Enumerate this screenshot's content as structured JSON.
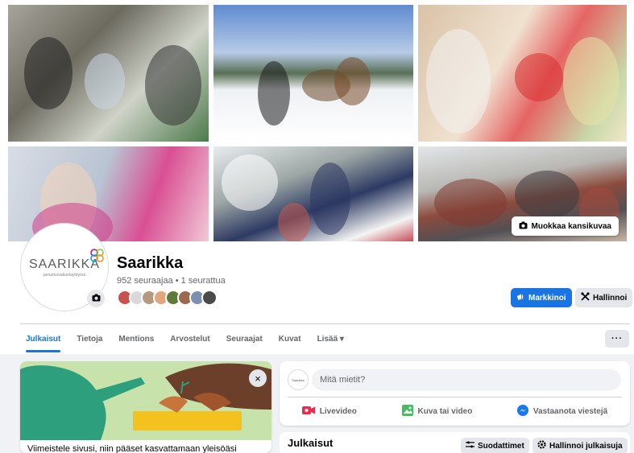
{
  "cover": {
    "edit_button_label": "Muokkaa kansikuvaa",
    "photo_tiles": [
      "cover-photo-1",
      "cover-photo-2",
      "cover-photo-3",
      "cover-photo-4",
      "cover-photo-5",
      "cover-photo-6"
    ]
  },
  "profile": {
    "logo_text": "SAARIKKA",
    "logo_subtext": "perusturvakuntayhtymä",
    "name": "Saarikka",
    "followers_line": "952 seuraajaa • 1 seurattua",
    "follower_avatar_count": 8,
    "camera_icon": "camera-icon"
  },
  "actions": {
    "promote_label": "Markkinoi",
    "manage_label": "Hallinnoi"
  },
  "tabs": [
    {
      "label": "Julkaisut",
      "active": true
    },
    {
      "label": "Tietoja",
      "active": false
    },
    {
      "label": "Mentions",
      "active": false
    },
    {
      "label": "Arvostelut",
      "active": false
    },
    {
      "label": "Seuraajat",
      "active": false
    },
    {
      "label": "Kuvat",
      "active": false
    },
    {
      "label": "Lisää ▾",
      "active": false
    }
  ],
  "more_button_label": "···",
  "promo": {
    "text": "Viimeistele sivusi, niin pääset kasvattamaan yleisöäsi",
    "close_label": "×"
  },
  "composer": {
    "avatar_text": "Saarikka",
    "placeholder": "Mitä mietit?",
    "actions": [
      {
        "label": "Livevideo",
        "icon": "live-video-icon",
        "color": "#f02849"
      },
      {
        "label": "Kuva tai video",
        "icon": "photo-video-icon",
        "color": "#45bd62"
      },
      {
        "label": "Vastaanota viestejä",
        "icon": "messenger-icon",
        "color": "#1877f2"
      }
    ]
  },
  "posts": {
    "title": "Julkaisut",
    "filters_label": "Suodattimet",
    "manage_posts_label": "Hallinnoi julkaisuja"
  },
  "colors": {
    "accent": "#1b74e4",
    "page_bg": "#f0f2f5",
    "secondary_button": "#e4e6eb",
    "muted_text": "#65676b"
  }
}
